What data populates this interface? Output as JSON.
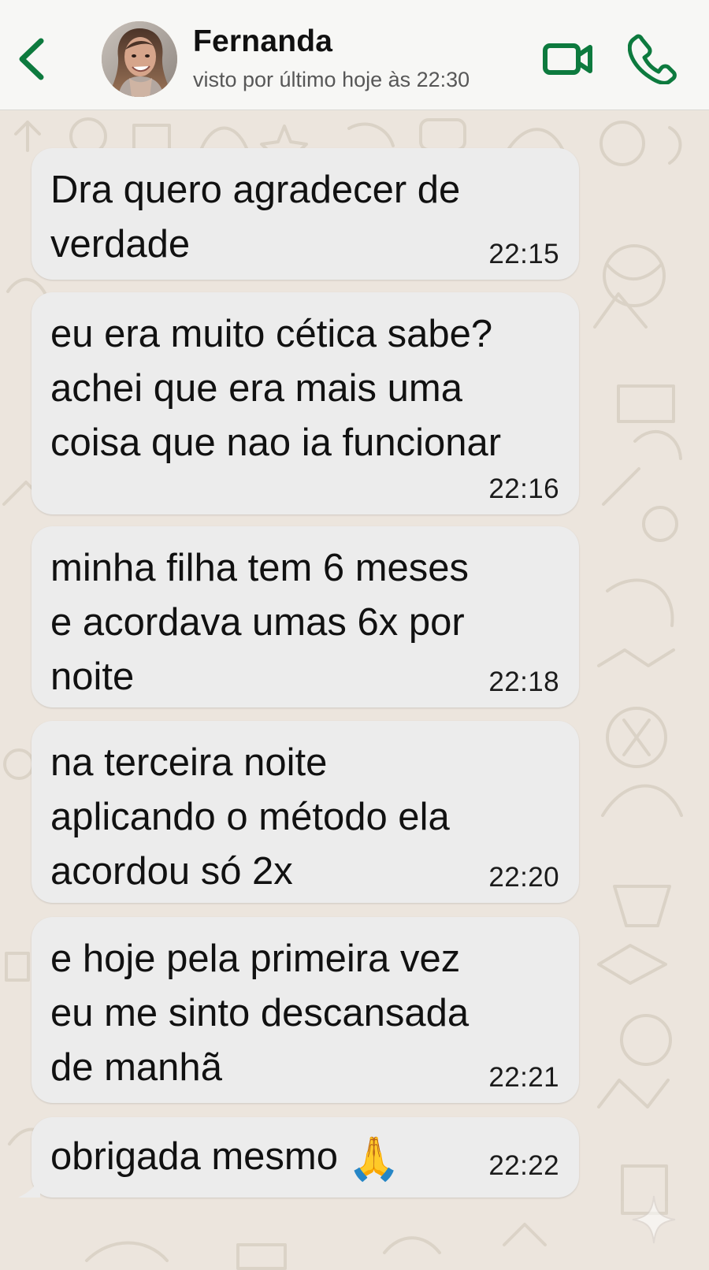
{
  "header": {
    "back_icon": "chevron-left-icon",
    "avatar_icon": "profile-avatar",
    "contact_name": "Fernanda",
    "status": "visto por último hoje às 22:30",
    "video_icon": "video-camera-icon",
    "phone_icon": "phone-icon",
    "accent_color": "#0d7a3e"
  },
  "chat": {
    "background_color": "#ece5dd",
    "bubble_color": "#ececec",
    "messages": [
      {
        "lines": [
          "Dra quero agradecer de",
          "verdade"
        ],
        "time": "22:15"
      },
      {
        "lines": [
          "eu era muito cética sabe?",
          "achei que era mais uma",
          "coisa que nao ia funcionar"
        ],
        "time": "22:16"
      },
      {
        "lines": [
          "minha filha tem 6 meses",
          "e acordava umas 6x por",
          "noite"
        ],
        "time": "22:18"
      },
      {
        "lines": [
          "na terceira noite",
          "aplicando o método ela",
          "acordou só 2x"
        ],
        "time": "22:20"
      },
      {
        "lines": [
          "e hoje pela primeira vez",
          "eu me sinto descansada",
          "de manhã"
        ],
        "time": "22:21"
      },
      {
        "lines": [
          "obrigada mesmo"
        ],
        "emoji": "🙏",
        "emoji_icon": "praying-hands-icon",
        "time": "22:22"
      }
    ]
  },
  "overlay": {
    "watermark_icon": "sparkle-icon"
  }
}
